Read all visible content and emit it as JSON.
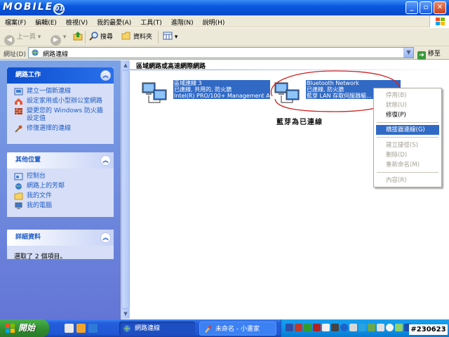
{
  "title_bar": {
    "logo_text": "MOBILE",
    "logo_circle": "01"
  },
  "menu": [
    "檔案(F)",
    "編輯(E)",
    "檢視(V)",
    "我的最愛(A)",
    "工具(T)",
    "進階(N)",
    "說明(H)"
  ],
  "toolbar": {
    "back": "上一頁",
    "search": "搜尋",
    "folders": "資料夾"
  },
  "address": {
    "label": "網址(D)",
    "value": "網路連線",
    "go": "移至"
  },
  "task_pane": {
    "network_tasks": {
      "title": "網路工作",
      "items": [
        "建立一個新連線",
        "設定家用或小型辦公室網路",
        "變更您的 Windows 防火牆設定值",
        "修復選擇的連線"
      ]
    },
    "other_places": {
      "title": "其他位置",
      "items": [
        "控制台",
        "網路上的芳鄰",
        "我的文件",
        "我的電腦"
      ]
    },
    "details": {
      "title": "詳細資料",
      "text": "選取了 2 個項目。"
    }
  },
  "content": {
    "section_title": "區域網路或高速網際網路",
    "connections": [
      {
        "name": "區域連線 3",
        "status": "已連線, 共用的, 防火牆",
        "device": "Intel(R) PRO/100+ Management Ad..."
      },
      {
        "name": "Bluetooth Network",
        "status": "已連線, 防火牆",
        "device": "藍芽 LAN 存取伺服器驅..."
      }
    ],
    "annotation": "藍芽為已連線"
  },
  "context_menu": {
    "items": [
      {
        "label": "停用(B)",
        "state": "disabled"
      },
      {
        "label": "狀態(U)",
        "state": "disabled"
      },
      {
        "label": "修復(P)",
        "state": "normal"
      },
      {
        "label": "橋接器連線(G)",
        "state": "selected"
      },
      {
        "label": "建立捷徑(S)",
        "state": "disabled"
      },
      {
        "label": "刪除(D)",
        "state": "disabled"
      },
      {
        "label": "重新命名(M)",
        "state": "disabled"
      },
      {
        "label": "內容(R)",
        "state": "disabled"
      }
    ]
  },
  "taskbar": {
    "start": "開始",
    "windows": [
      {
        "label": "網路連線",
        "active": true
      },
      {
        "label": "未命名 - 小畫家",
        "active": false
      }
    ],
    "clock": "#230623"
  }
}
